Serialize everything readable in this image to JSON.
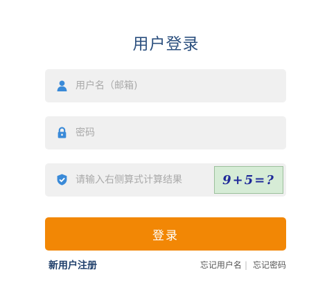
{
  "login": {
    "title": "用户登录",
    "username_placeholder": "用户名（邮箱)",
    "password_placeholder": "密码",
    "captcha_placeholder": "请输入右侧算式计算结果",
    "captcha_text": "9+5=?",
    "submit_label": "登录",
    "register_link": "新用户注册",
    "forgot_username": "忘记用户名",
    "forgot_separator": "|",
    "forgot_password": "忘记密码"
  },
  "icons": {
    "username": "user-icon",
    "password": "lock-icon",
    "captcha": "shield-check-icon"
  },
  "colors": {
    "title": "#2b4f7e",
    "icon": "#3a8ad8",
    "button": "#f28705",
    "field_bg": "#f0f0f0",
    "register_link": "#1f3f6b"
  }
}
